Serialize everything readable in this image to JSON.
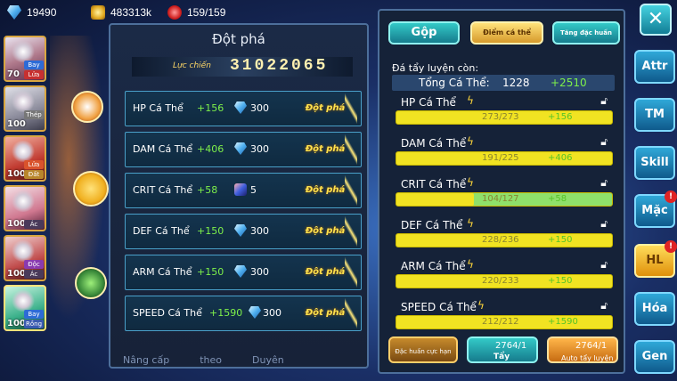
{
  "topbar": {
    "diamonds": "19490",
    "gold": "483313k",
    "stamina": "159/159"
  },
  "roster": [
    {
      "level": "70",
      "tags": [
        "Bay",
        "Lửa"
      ]
    },
    {
      "level": "100",
      "tags": [
        "Thép",
        ""
      ]
    },
    {
      "level": "100",
      "tags": [
        "Lửa",
        "Đất"
      ]
    },
    {
      "level": "100",
      "tags": [
        "",
        "Ác"
      ]
    },
    {
      "level": "100",
      "tags": [
        "Độc",
        "Ác"
      ]
    },
    {
      "level": "100",
      "tags": [
        "Bay",
        "Rồng"
      ]
    }
  ],
  "breakthrough_panel": {
    "title": "Đột phá",
    "power_label": "Lực chiến",
    "power_value": "31022065",
    "rows": [
      {
        "name": "HP Cá Thể",
        "bonus": "+156",
        "cost": "300",
        "button": "Đột phá"
      },
      {
        "name": "DAM Cá Thể",
        "bonus": "+406",
        "cost": "300",
        "button": "Đột phá"
      },
      {
        "name": "CRIT Cá Thể",
        "bonus": "+58",
        "cost": "5",
        "button": "Đột phá"
      },
      {
        "name": "DEF Cá Thể",
        "bonus": "+150",
        "cost": "300",
        "button": "Đột phá"
      },
      {
        "name": "ARM Cá Thể",
        "bonus": "+150",
        "cost": "300",
        "button": "Đột phá"
      },
      {
        "name": "SPEED Cá Thể",
        "bonus": "+1590",
        "cost": "300",
        "button": "Đột phá"
      }
    ],
    "bottom_tabs": [
      "Nâng cấp",
      "theo",
      "Duyên"
    ]
  },
  "training_panel": {
    "tabs": [
      "Gộp",
      "Điểm cá thể",
      "Tăng đặc huấn"
    ],
    "remaining_label": "Đá tẩy luyện còn:",
    "total_label": "Tổng Cá Thể:",
    "total_value": "1228",
    "total_bonus": "+2510",
    "stats": [
      {
        "name": "HP Cá Thể",
        "value": "273/273",
        "bonus": "+156",
        "fill": 1.0
      },
      {
        "name": "DAM Cá Thể",
        "value": "191/225",
        "bonus": "+406",
        "fill": 0.0
      },
      {
        "name": "CRIT Cá Thể",
        "value": "104/127",
        "bonus": "+58",
        "fill": 0.36
      },
      {
        "name": "DEF Cá Thể",
        "value": "228/236",
        "bonus": "+150",
        "fill": 0.0
      },
      {
        "name": "ARM Cá Thể",
        "value": "220/233",
        "bonus": "+150",
        "fill": 0.0
      },
      {
        "name": "SPEED Cá Thể",
        "value": "212/212",
        "bonus": "+1590",
        "fill": 0.0
      }
    ],
    "buttons": {
      "special": "Đặc huấn cực hạn",
      "wash_count": "2764/1",
      "wash_label": "Tẩy",
      "auto_count": "2764/1",
      "auto_label": "Auto tẩy luyện"
    }
  },
  "side_nav": [
    "Attr",
    "TM",
    "Skill",
    "Mặc",
    "HL",
    "Hóa",
    "Gen"
  ],
  "side_nav_badges": {
    "Mặc": "!",
    "HL": "!"
  },
  "colors": {
    "bonus_green": "#7ef04a",
    "gold": "#ffe14d",
    "panel_border": "#4d6f9b"
  }
}
